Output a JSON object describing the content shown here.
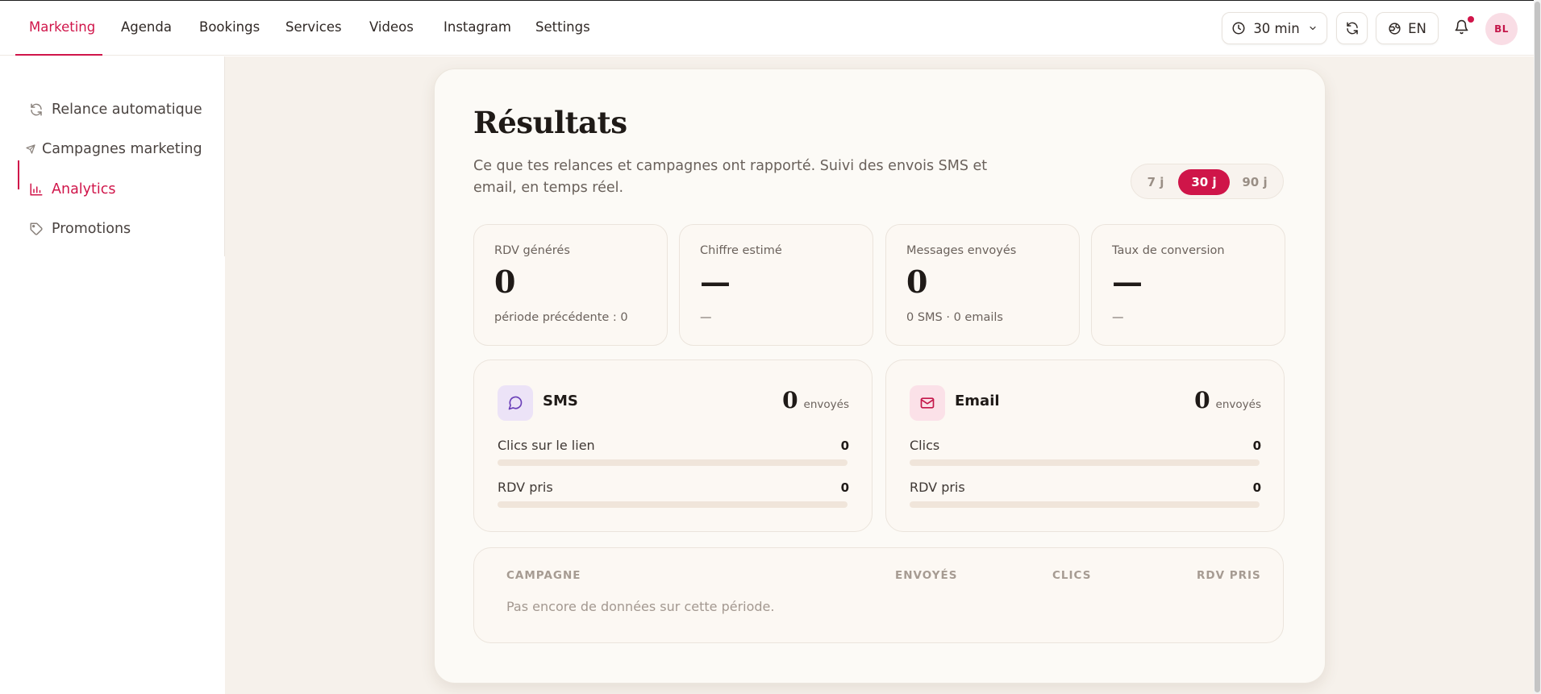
{
  "topnav": {
    "tabs": [
      {
        "label": "Marketing",
        "active": true
      },
      {
        "label": "Agenda"
      },
      {
        "label": "Bookings"
      },
      {
        "label": "Services"
      },
      {
        "label": "Videos"
      },
      {
        "label": "Instagram"
      },
      {
        "label": "Settings"
      }
    ],
    "duration_label": "30 min",
    "language_label": "EN",
    "avatar_initials": "BL",
    "has_notification": true
  },
  "sidebar": {
    "items": [
      {
        "label": "Relance automatique",
        "icon": "refresh-icon"
      },
      {
        "label": "Campagnes marketing",
        "icon": "send-icon"
      },
      {
        "label": "Analytics",
        "icon": "bar-chart-icon",
        "active": true
      },
      {
        "label": "Promotions",
        "icon": "tag-icon"
      }
    ]
  },
  "results": {
    "title": "Résultats",
    "subtitle": "Ce que tes relances et campagnes ont rapporté. Suivi des envois SMS et email, en temps réel.",
    "periods": [
      {
        "label": "7 j"
      },
      {
        "label": "30 j",
        "active": true
      },
      {
        "label": "90 j"
      }
    ],
    "stats": [
      {
        "label": "RDV générés",
        "value": "0",
        "foot": "période précédente : 0"
      },
      {
        "label": "Chiffre estimé",
        "value": "—",
        "foot": "—"
      },
      {
        "label": "Messages envoyés",
        "value": "0",
        "foot": "0 SMS · 0 emails"
      },
      {
        "label": "Taux de conversion",
        "value": "—",
        "foot": "—"
      }
    ],
    "channels": [
      {
        "name": "SMS",
        "icon": "chat-bubble-icon",
        "sent": "0",
        "sent_unit": "envoyés",
        "rows": [
          {
            "label": "Clics sur le lien",
            "value": "0",
            "progress": 0
          },
          {
            "label": "RDV pris",
            "value": "0",
            "progress": 0
          }
        ]
      },
      {
        "name": "Email",
        "icon": "mail-icon",
        "sent": "0",
        "sent_unit": "envoyés",
        "rows": [
          {
            "label": "Clics",
            "value": "0",
            "progress": 0
          },
          {
            "label": "RDV pris",
            "value": "0",
            "progress": 0
          }
        ]
      }
    ],
    "table": {
      "columns": [
        "CAMPAGNE",
        "ENVOYÉS",
        "CLICS",
        "RDV PRIS"
      ],
      "empty_text": "Pas encore de données sur cette période."
    }
  },
  "colors": {
    "accent": "#d0154a",
    "background": "#f6f1eb",
    "card": "#fcfaf6",
    "sms_icon_bg": "#ece3f7",
    "email_icon_bg": "#fbe1e8"
  }
}
